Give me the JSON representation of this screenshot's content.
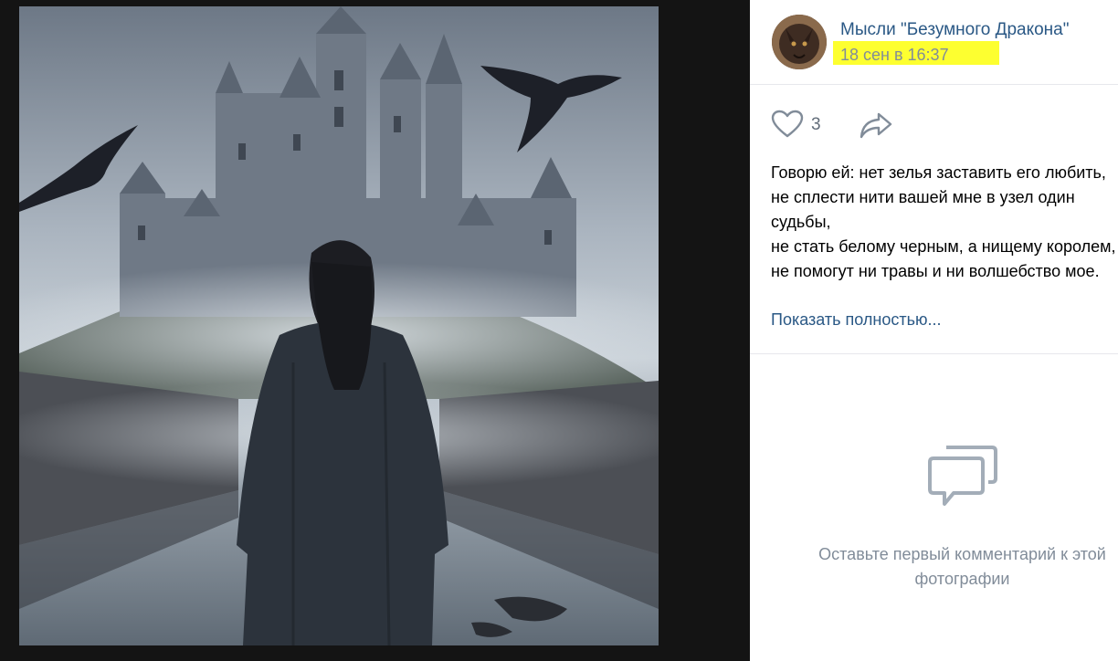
{
  "post": {
    "author_name": "Мысли \"Безумного Дракона\"",
    "date": "18 сен в 16:37",
    "likes_count": "3",
    "text_lines": [
      "Говорю ей: нет зелья заставить его любить,",
      "не сплести нити вашей мне в узел один",
      "судьбы,",
      "не стать белому черным, а нищему королем,",
      "не помогут ни травы и ни волшебство мое."
    ],
    "show_more_label": "Показать полностью..."
  },
  "comments": {
    "empty_line_1": "Оставьте первый комментарий к этой",
    "empty_line_2": "фотографии"
  },
  "icons": {
    "like": "heart-icon",
    "share": "share-arrow-icon",
    "comments": "speech-bubbles-icon"
  },
  "colors": {
    "link": "#2a5885",
    "secondary": "#818c99",
    "highlight": "#fdff30",
    "photo_background": "#141414"
  }
}
